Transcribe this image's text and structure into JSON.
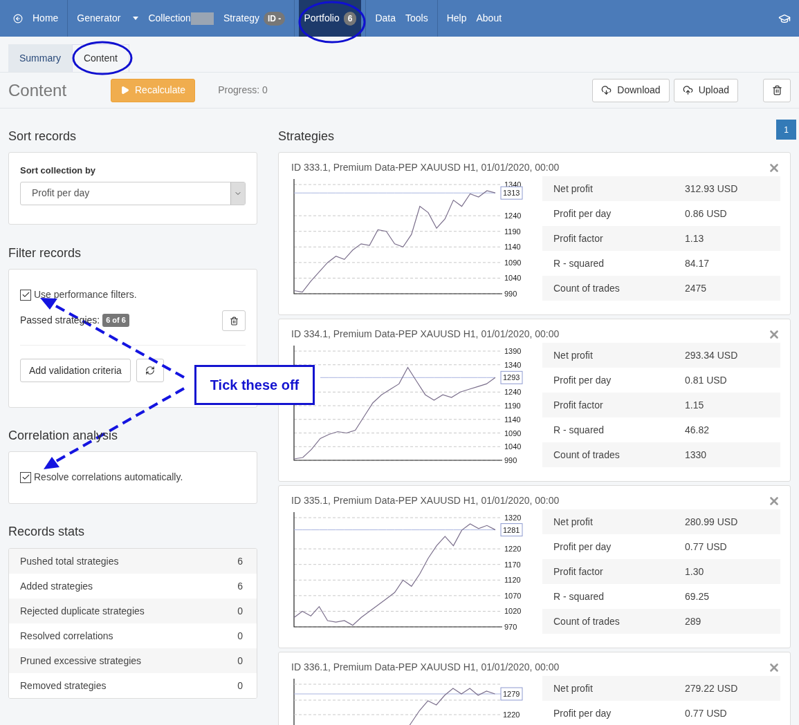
{
  "nav": {
    "groups": [
      [
        {
          "label": "Home",
          "kind": "home",
          "selected": false
        }
      ],
      [
        {
          "label": "Generator",
          "kind": "dropdown",
          "selected": false
        },
        {
          "label": "Collection",
          "kind": "redacted",
          "selected": false
        },
        {
          "label": "Strategy",
          "kind": "badge",
          "badge": "ID -",
          "selected": false
        }
      ],
      [
        {
          "label": "Portfolio",
          "kind": "badge",
          "badge": "6",
          "selected": true
        }
      ],
      [
        {
          "label": "Data",
          "kind": "plain",
          "selected": false
        },
        {
          "label": "Tools",
          "kind": "plain",
          "selected": false
        }
      ],
      [
        {
          "label": "Help",
          "kind": "plain",
          "selected": false
        },
        {
          "label": "About",
          "kind": "plain",
          "selected": false
        }
      ]
    ]
  },
  "tabs": [
    {
      "label": "Summary",
      "selected": false
    },
    {
      "label": "Content",
      "selected": true
    }
  ],
  "toolbar": {
    "title": "Content",
    "recalculate": "Recalculate",
    "progress": "Progress: 0",
    "download": "Download",
    "upload": "Upload"
  },
  "sort": {
    "heading": "Sort records",
    "label": "Sort collection by",
    "value": "Profit per day"
  },
  "filter": {
    "heading": "Filter records",
    "checkbox": {
      "label": "Use performance filters.",
      "checked": true
    },
    "passed_label": "Passed strategies:",
    "passed_badge": "6 of 6",
    "add_button": "Add validation criteria"
  },
  "correlation": {
    "heading": "Correlation analysis",
    "checkbox": {
      "label": "Resolve correlations automatically.",
      "checked": true
    }
  },
  "stats": {
    "heading": "Records stats",
    "rows": [
      {
        "label": "Pushed total strategies",
        "value": "6"
      },
      {
        "label": "Added strategies",
        "value": "6"
      },
      {
        "label": "Rejected duplicate strategies",
        "value": "0"
      },
      {
        "label": "Resolved correlations",
        "value": "0"
      },
      {
        "label": "Pruned excessive strategies",
        "value": "0"
      },
      {
        "label": "Removed strategies",
        "value": "0"
      }
    ]
  },
  "strategies": {
    "heading": "Strategies",
    "pages": [
      {
        "label": "1",
        "selected": true
      }
    ],
    "items": [
      {
        "title": "ID 333.1, Premium Data-PEP XAUUSD H1, 01/01/2020, 00:00",
        "chart_data": {
          "type": "line",
          "grid": true,
          "ylim": [
            990,
            1340
          ],
          "yticks": [
            990,
            1040,
            1090,
            1140,
            1190,
            1240,
            1340
          ],
          "series": [
            {
              "color": "#7b6f8c",
              "values": [
                1000,
                995,
                1030,
                1060,
                1090,
                1110,
                1100,
                1130,
                1150,
                1145,
                1195,
                1190,
                1150,
                1140,
                1180,
                1270,
                1250,
                1200,
                1230,
                1290,
                1270,
                1310,
                1300,
                1320,
                1313
              ]
            },
            {
              "color": "#a9b4e0",
              "values": [
                1313,
                1313,
                1313,
                1313,
                1313,
                1313,
                1313,
                1313,
                1313,
                1313,
                1313,
                1313,
                1313,
                1313,
                1313,
                1313,
                1313,
                1313,
                1313,
                1313,
                1313,
                1313,
                1313,
                1313,
                1313
              ]
            }
          ],
          "annotations": [
            {
              "text": "1313"
            }
          ]
        },
        "stats": [
          {
            "label": "Net profit",
            "value": "312.93 USD"
          },
          {
            "label": "Profit per day",
            "value": "0.86 USD"
          },
          {
            "label": "Profit factor",
            "value": "1.13"
          },
          {
            "label": "R - squared",
            "value": "84.17"
          },
          {
            "label": "Count of trades",
            "value": "2475"
          }
        ]
      },
      {
        "title": "ID 334.1, Premium Data-PEP XAUUSD H1, 01/01/2020, 00:00",
        "chart_data": {
          "type": "line",
          "grid": true,
          "ylim": [
            990,
            1390
          ],
          "yticks": [
            990,
            1040,
            1090,
            1140,
            1190,
            1240,
            1340,
            1390
          ],
          "series": [
            {
              "color": "#7b6f8c",
              "values": [
                995,
                1000,
                1030,
                1070,
                1085,
                1095,
                1090,
                1100,
                1150,
                1200,
                1230,
                1250,
                1270,
                1330,
                1280,
                1230,
                1210,
                1230,
                1220,
                1240,
                1250,
                1260,
                1270,
                1293
              ]
            },
            {
              "color": "#a9b4e0",
              "values": [
                null,
                null,
                null,
                1293,
                1293,
                1293,
                1293,
                1293,
                1293,
                1293,
                1293,
                1293,
                1293,
                1293,
                1293,
                1293,
                1293,
                1293,
                1293,
                1293,
                1293,
                1293,
                1293,
                1293
              ]
            }
          ],
          "annotations": [
            {
              "text": "1293"
            }
          ]
        },
        "stats": [
          {
            "label": "Net profit",
            "value": "293.34 USD"
          },
          {
            "label": "Profit per day",
            "value": "0.81 USD"
          },
          {
            "label": "Profit factor",
            "value": "1.15"
          },
          {
            "label": "R - squared",
            "value": "46.82"
          },
          {
            "label": "Count of trades",
            "value": "1330"
          }
        ]
      },
      {
        "title": "ID 335.1, Premium Data-PEP XAUUSD H1, 01/01/2020, 00:00",
        "chart_data": {
          "type": "line",
          "grid": true,
          "ylim": [
            970,
            1320
          ],
          "yticks": [
            970,
            1020,
            1070,
            1120,
            1170,
            1220,
            1320
          ],
          "series": [
            {
              "color": "#7b6f8c",
              "values": [
                1000,
                1020,
                1005,
                1035,
                990,
                985,
                990,
                975,
                1000,
                1020,
                1040,
                1060,
                1080,
                1120,
                1100,
                1140,
                1190,
                1230,
                1260,
                1230,
                1280,
                1300,
                1285,
                1295,
                1281
              ]
            },
            {
              "color": "#a9b4e0",
              "values": [
                1281,
                1281,
                1281,
                1281,
                1281,
                1281,
                1281,
                1281,
                1281,
                1281,
                1281,
                1281,
                1281,
                1281,
                1281,
                1281,
                1281,
                1281,
                1281,
                1281,
                1281,
                1281,
                1281,
                1281,
                1281
              ]
            }
          ],
          "annotations": [
            {
              "text": "1281"
            }
          ]
        },
        "stats": [
          {
            "label": "Net profit",
            "value": "280.99 USD"
          },
          {
            "label": "Profit per day",
            "value": "0.77 USD"
          },
          {
            "label": "Profit factor",
            "value": "1.30"
          },
          {
            "label": "R - squared",
            "value": "69.25"
          },
          {
            "label": "Count of trades",
            "value": "289"
          }
        ]
      },
      {
        "title": "ID 336.1, Premium Data-PEP XAUUSD H1, 01/01/2020, 00:00",
        "chart_labels": [
          "1279",
          "1220"
        ],
        "stats": [
          {
            "label": "Net profit",
            "value": "279.22 USD"
          },
          {
            "label": "Profit per day",
            "value": "0.77 USD"
          }
        ]
      }
    ]
  },
  "callout": {
    "text": "Tick these off"
  }
}
